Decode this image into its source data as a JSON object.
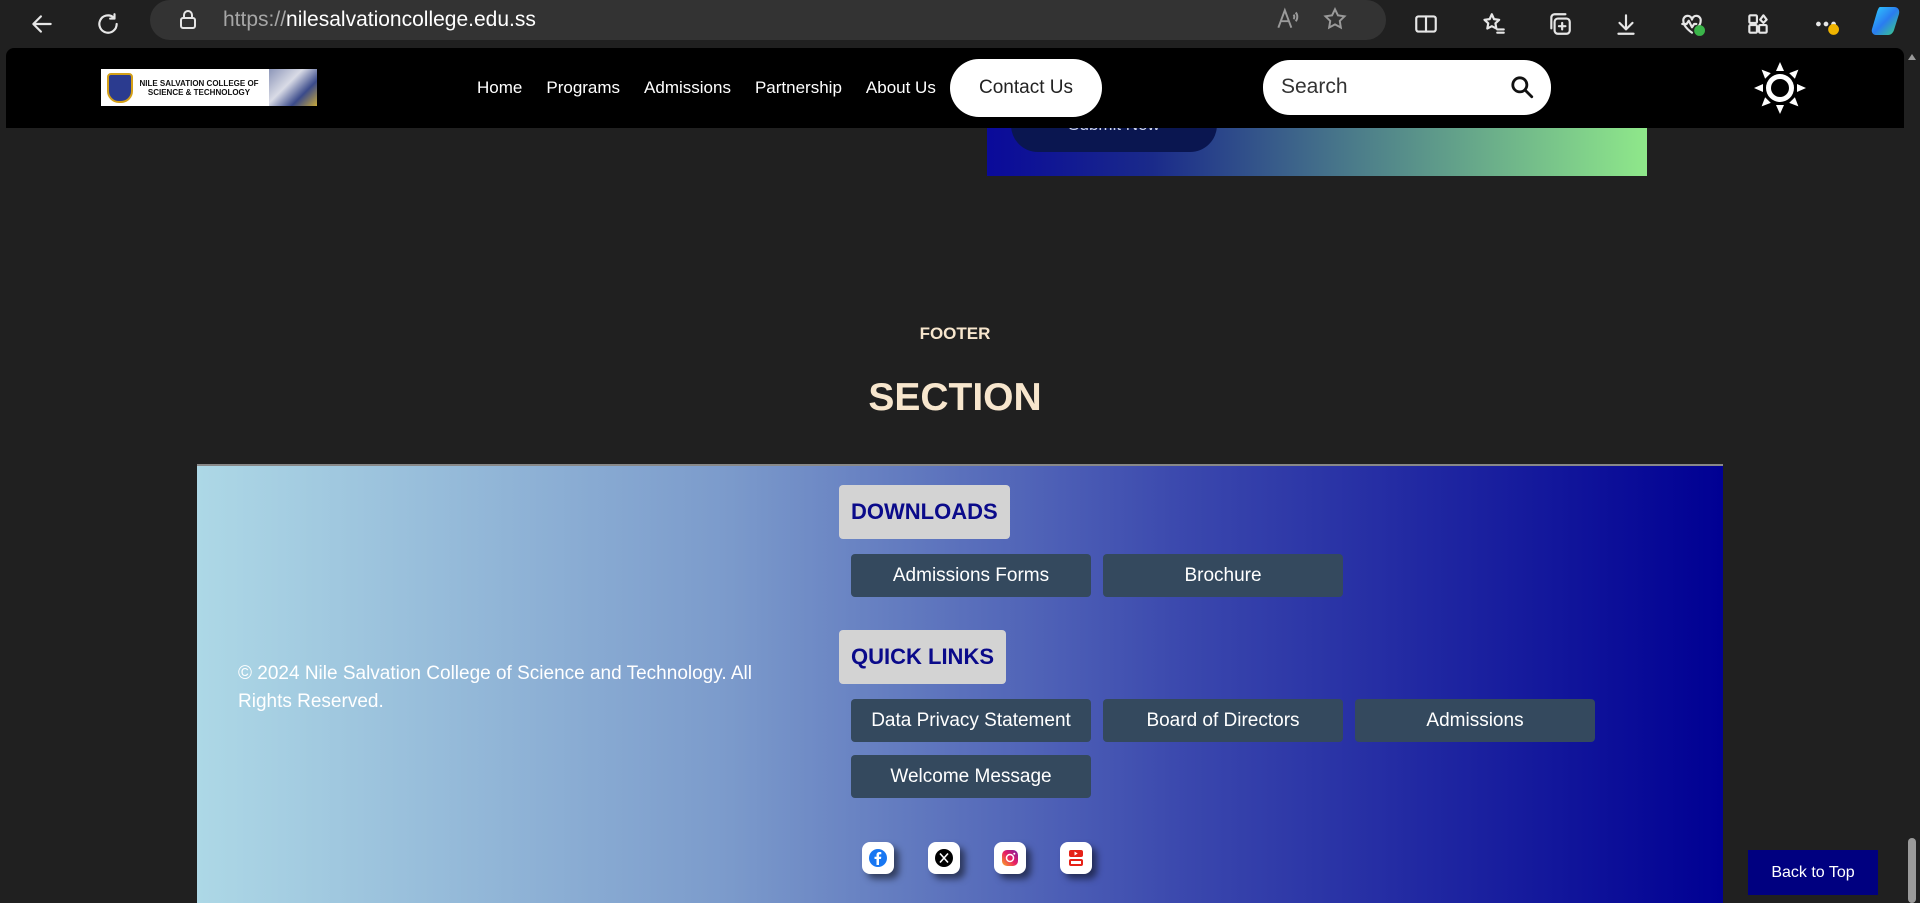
{
  "browser": {
    "url_protocol": "https://",
    "url_host": "nilesalvationcollege.edu.ss"
  },
  "header": {
    "logo_text": "NILE SALVATION COLLEGE OF SCIENCE & TECHNOLOGY",
    "nav": [
      "Home",
      "Programs",
      "Admissions",
      "Partnership",
      "About Us"
    ],
    "contact_label": "Contact Us",
    "search_placeholder": "Search"
  },
  "form_card": {
    "submit_label": "Submit Now"
  },
  "footer": {
    "eyebrow": "FOOTER",
    "title": "SECTION",
    "copyright": "© 2024 Nile Salvation College of Science and Technology. All Rights Reserved.",
    "downloads_label": "DOWNLOADS",
    "downloads": [
      "Admissions Forms",
      "Brochure"
    ],
    "quick_links_label": "QUICK LINKS",
    "quick_links": [
      "Data Privacy Statement",
      "Board of Directors",
      "Admissions",
      "Welcome Message"
    ],
    "socials": [
      "facebook-icon",
      "x-twitter-icon",
      "instagram-icon",
      "youtube-icon"
    ]
  },
  "back_to_top": "Back to Top",
  "colors": {
    "accent_navy": "#000080",
    "button_slate": "#34495e",
    "heading_cream": "#f7e6cd"
  }
}
